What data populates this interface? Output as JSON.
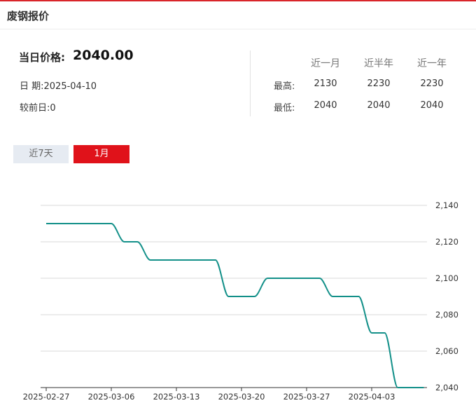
{
  "header": {
    "title": "废钢报价"
  },
  "summary": {
    "price_label": "当日价格:",
    "price_value": "2040.00",
    "date_text": "日  期:2025-04-10",
    "change_text": "较前日:0"
  },
  "stats": {
    "columns": [
      "近一月",
      "近半年",
      "近一年"
    ],
    "high_label": "最高:",
    "low_label": "最低:",
    "high": [
      "2130",
      "2230",
      "2230"
    ],
    "low": [
      "2040",
      "2040",
      "2040"
    ]
  },
  "tabs": {
    "items": [
      "近7天",
      "1月"
    ],
    "active": "1月"
  },
  "colors": {
    "accent_red": "#e0121a",
    "line": "#139089",
    "grid": "#d9d9d9"
  },
  "chart_data": {
    "type": "line",
    "x": [
      "2025-02-27",
      "2025-02-28",
      "2025-03-03",
      "2025-03-04",
      "2025-03-05",
      "2025-03-06",
      "2025-03-07",
      "2025-03-10",
      "2025-03-11",
      "2025-03-12",
      "2025-03-13",
      "2025-03-14",
      "2025-03-17",
      "2025-03-18",
      "2025-03-19",
      "2025-03-20",
      "2025-03-21",
      "2025-03-24",
      "2025-03-25",
      "2025-03-26",
      "2025-03-27",
      "2025-03-28",
      "2025-03-31",
      "2025-04-01",
      "2025-04-02",
      "2025-04-03",
      "2025-04-07",
      "2025-04-08",
      "2025-04-09",
      "2025-04-10"
    ],
    "series": [
      {
        "values": [
          2130,
          2130,
          2130,
          2130,
          2130,
          2130,
          2120,
          2120,
          2110,
          2110,
          2110,
          2110,
          2110,
          2110,
          2090,
          2090,
          2090,
          2100,
          2100,
          2100,
          2100,
          2100,
          2090,
          2090,
          2090,
          2070,
          2070,
          2040,
          2040,
          2040
        ]
      }
    ],
    "x_tick_labels": [
      "2025-02-27",
      "2025-03-06",
      "2025-03-13",
      "2025-03-20",
      "2025-03-27",
      "2025-04-03"
    ],
    "y_ticks": [
      "2,040",
      "2,060",
      "2,080",
      "2,100",
      "2,120",
      "2,140"
    ],
    "ylim": [
      2040,
      2140
    ],
    "grid": true,
    "y_axis_position": "right"
  }
}
